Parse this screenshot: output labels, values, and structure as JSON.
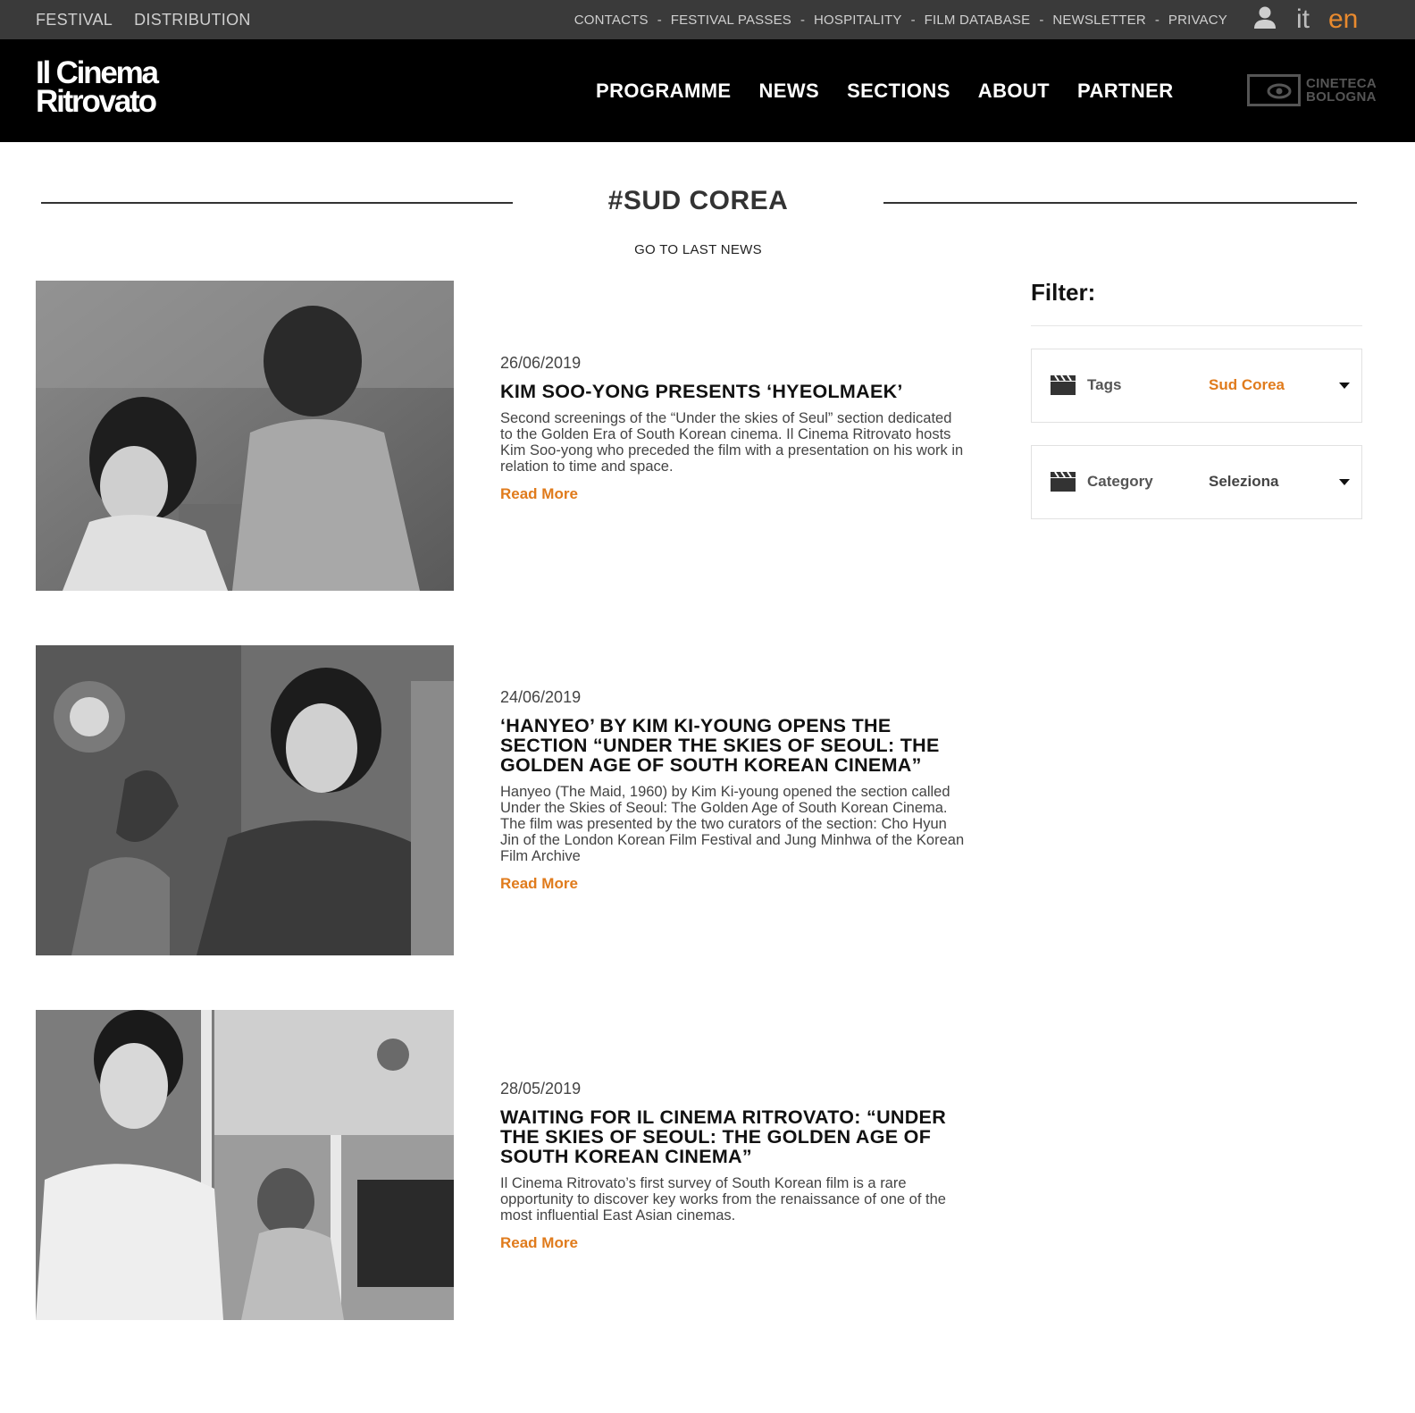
{
  "topbar": {
    "left_links": [
      "FESTIVAL",
      "DISTRIBUTION"
    ],
    "right_links": [
      "CONTACTS",
      "FESTIVAL PASSES",
      "HOSPITALITY",
      "FILM DATABASE",
      "NEWSLETTER",
      "PRIVACY"
    ],
    "separator": "-",
    "user_icon": "user-icon",
    "lang_it": "it",
    "lang_en": "en",
    "active_lang_color": "#e98a2e"
  },
  "header": {
    "logo_line1": "Il Cinema",
    "logo_line2": "Ritrovato",
    "nav": [
      "PROGRAMME",
      "NEWS",
      "SECTIONS",
      "ABOUT",
      "PARTNER"
    ],
    "partner_logo_line1": "CINETECA",
    "partner_logo_line2": "BOLOGNA"
  },
  "page": {
    "title": "#SUD COREA",
    "last_news": "GO TO LAST NEWS"
  },
  "articles": [
    {
      "date": "26/06/2019",
      "title": "KIM SOO-YONG PRESENTS ‘HYEOLMAEK’",
      "excerpt": "Second screenings of the “Under the skies of Seul” section dedicated to the Golden Era of South Korean cinema. Il Cinema Ritrovato hosts Kim Soo-yong who preceded the film with a presentation on his work in relation to time and space.",
      "read_more": "Read More"
    },
    {
      "date": "24/06/2019",
      "title": "‘HANYEO’ BY KIM KI-YOUNG OPENS THE SECTION “UNDER THE SKIES OF SEOUL: THE GOLDEN AGE OF SOUTH KOREAN CINEMA”",
      "excerpt": "Hanyeo (The Maid, 1960) by Kim Ki-young opened the section called Under the Skies of Seoul: The Golden Age of South Korean Cinema. The film was presented by the two curators of the section: Cho Hyun Jin of the London Korean Film Festival and Jung Minhwa of the Korean Film Archive",
      "read_more": "Read More"
    },
    {
      "date": "28/05/2019",
      "title": "WAITING FOR IL CINEMA RITROVATO: “UNDER THE SKIES OF SEOUL: THE GOLDEN AGE OF SOUTH KOREAN CINEMA”",
      "excerpt": "Il Cinema Ritrovato’s first survey of South Korean film is a rare opportunity to discover key works from the renaissance of one of the most influential East Asian cinemas.",
      "read_more": "Read More"
    }
  ],
  "sidebar": {
    "filter_title": "Filter:",
    "filters": [
      {
        "icon": "clapperboard-icon",
        "label": "Tags",
        "value": "Sud Corea",
        "value_color": "#e07b1c"
      },
      {
        "icon": "clapperboard-icon",
        "label": "Category",
        "value": "Seleziona",
        "value_color": "#444444"
      }
    ]
  },
  "colors": {
    "accent": "#e07b1c",
    "topbar_bg": "#3a3a3a",
    "header_bg": "#000000"
  }
}
